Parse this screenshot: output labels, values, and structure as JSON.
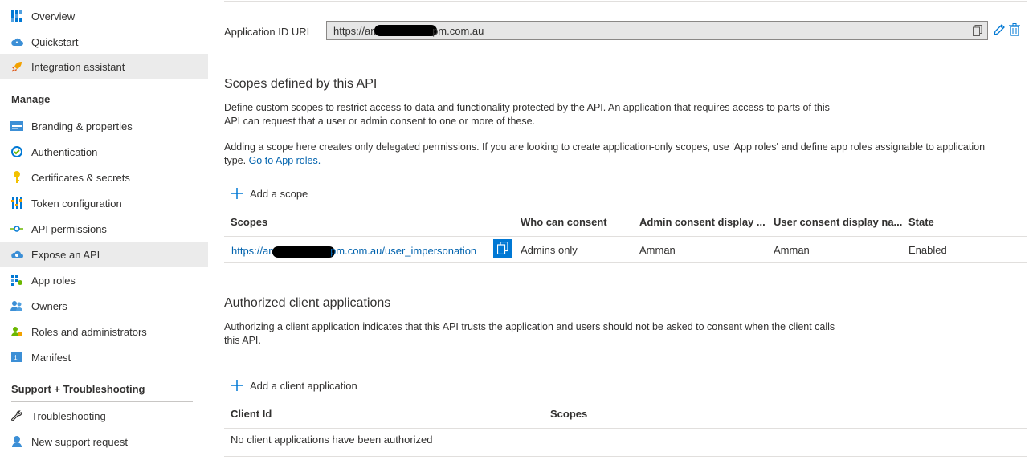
{
  "sidebar": {
    "items_top": [
      {
        "label": "Overview",
        "icon": "overview-grid-icon"
      },
      {
        "label": "Quickstart",
        "icon": "cloud-quickstart-icon"
      },
      {
        "label": "Integration assistant",
        "icon": "rocket-icon"
      }
    ],
    "manage_heading": "Manage",
    "manage_items": [
      {
        "label": "Branding & properties",
        "icon": "branding-icon"
      },
      {
        "label": "Authentication",
        "icon": "authentication-icon"
      },
      {
        "label": "Certificates & secrets",
        "icon": "key-icon"
      },
      {
        "label": "Token configuration",
        "icon": "token-config-icon"
      },
      {
        "label": "API permissions",
        "icon": "api-permissions-icon"
      },
      {
        "label": "Expose an API",
        "icon": "cloud-api-icon"
      },
      {
        "label": "App roles",
        "icon": "app-roles-icon"
      },
      {
        "label": "Owners",
        "icon": "owners-icon"
      },
      {
        "label": "Roles and administrators",
        "icon": "roles-admin-icon"
      },
      {
        "label": "Manifest",
        "icon": "manifest-icon"
      }
    ],
    "support_heading": "Support + Troubleshooting",
    "support_items": [
      {
        "label": "Troubleshooting",
        "icon": "wrench-icon"
      },
      {
        "label": "New support request",
        "icon": "support-person-icon"
      }
    ],
    "active_item": "Expose an API"
  },
  "app_id_uri": {
    "label": "Application ID URI",
    "value_start": "https://am",
    "value_end": "pm.com.au"
  },
  "scopes": {
    "heading": "Scopes defined by this API",
    "desc1_line1": "Define custom scopes to restrict access to data and functionality protected by the API. An application that requires access to parts of this",
    "desc1_line2": "API can request that a user or admin consent to one or more of these.",
    "desc2_line1": "Adding a scope here creates only delegated permissions. If you are looking to create application-only scopes, use 'App roles' and define app roles assignable to application",
    "desc2_line2_prefix": "type. ",
    "desc2_link": "Go to App roles.",
    "add_label": "Add a scope",
    "columns": [
      "Scopes",
      "Who can consent",
      "Admin consent display ...",
      "User consent display na...",
      "State"
    ],
    "rows": [
      {
        "scope_start": "https://am",
        "scope_end": "pm.com.au/user_impersonation",
        "who": "Admins only",
        "admin_display": "Amman",
        "user_display": "Amman",
        "state": "Enabled"
      }
    ]
  },
  "clients": {
    "heading": "Authorized client applications",
    "desc_line1": "Authorizing a client application indicates that this API trusts the application and users should not be asked to consent when the client calls",
    "desc_line2": "this API.",
    "add_label": "Add a client application",
    "columns": [
      "Client Id",
      "Scopes"
    ],
    "empty_text": "No client applications have been authorized"
  },
  "colors": {
    "accent": "#0078d4",
    "link": "#0062ad",
    "active_bg": "#ebebeb"
  }
}
